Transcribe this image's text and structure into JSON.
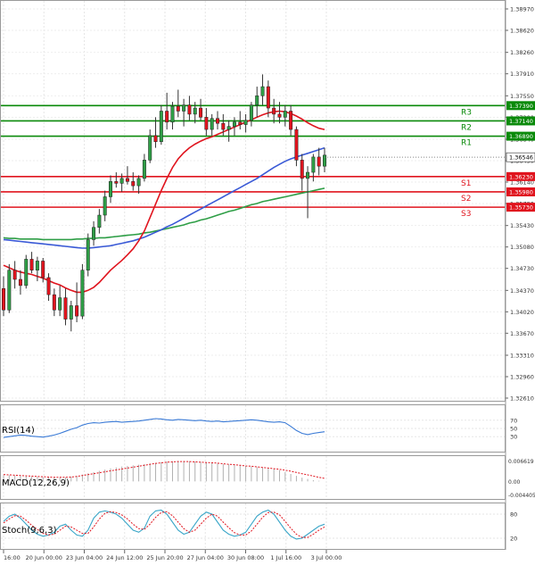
{
  "chart_data": {
    "type": "candlestick",
    "main": {
      "ylim": [
        1.3261,
        1.3897
      ],
      "y_ticks": [
        "1.38970",
        "1.38620",
        "1.38260",
        "1.37910",
        "1.37550",
        "1.37200",
        "1.36840",
        "1.36490",
        "1.36140",
        "1.35790",
        "1.35430",
        "1.35080",
        "1.34730",
        "1.34370",
        "1.34020",
        "1.33670",
        "1.33310",
        "1.32960",
        "1.32610"
      ],
      "x_labels": [
        "16:00",
        "20 Jun 00:00",
        "23 Jun 04:00",
        "24 Jun 12:00",
        "25 Jun 20:00",
        "27 Jun 04:00",
        "30 Jun 08:00",
        "1 Jul 16:00",
        "3 Jul 00:00"
      ],
      "levels": [
        {
          "name": "R3",
          "value": 1.3739,
          "label": "1.37390",
          "color": "#0a8a0a"
        },
        {
          "name": "R2",
          "value": 1.3714,
          "label": "1.37140",
          "color": "#0a8a0a"
        },
        {
          "name": "R1",
          "value": 1.3689,
          "label": "1.36890",
          "color": "#0a8a0a"
        },
        {
          "name": "S1",
          "value": 1.3623,
          "label": "1.36230",
          "color": "#e0141e"
        },
        {
          "name": "S2",
          "value": 1.3598,
          "label": "1.35980",
          "color": "#e0141e"
        },
        {
          "name": "S3",
          "value": 1.3573,
          "label": "1.35730",
          "color": "#e0141e"
        }
      ],
      "current_price": {
        "value": 1.36546,
        "label": "1.36546"
      },
      "candles": [
        [
          1.344,
          1.346,
          1.3395,
          1.3405
        ],
        [
          1.3405,
          1.348,
          1.34,
          1.347
        ],
        [
          1.347,
          1.3485,
          1.344,
          1.3455
        ],
        [
          1.3455,
          1.347,
          1.343,
          1.3445
        ],
        [
          1.3445,
          1.3495,
          1.344,
          1.3488
        ],
        [
          1.3488,
          1.35,
          1.3465,
          1.347
        ],
        [
          1.347,
          1.3492,
          1.3452,
          1.3485
        ],
        [
          1.3485,
          1.349,
          1.345,
          1.3458
        ],
        [
          1.3458,
          1.3465,
          1.342,
          1.343
        ],
        [
          1.343,
          1.344,
          1.3395,
          1.3405
        ],
        [
          1.3405,
          1.3445,
          1.3395,
          1.3425
        ],
        [
          1.3425,
          1.344,
          1.338,
          1.339
        ],
        [
          1.339,
          1.342,
          1.337,
          1.3412
        ],
        [
          1.3412,
          1.345,
          1.3385,
          1.3395
        ],
        [
          1.3395,
          1.348,
          1.339,
          1.347
        ],
        [
          1.347,
          1.353,
          1.346,
          1.352
        ],
        [
          1.352,
          1.355,
          1.351,
          1.354
        ],
        [
          1.354,
          1.357,
          1.353,
          1.356
        ],
        [
          1.356,
          1.36,
          1.355,
          1.359
        ],
        [
          1.359,
          1.3625,
          1.358,
          1.3615
        ],
        [
          1.3615,
          1.363,
          1.3605,
          1.3612
        ],
        [
          1.3612,
          1.3628,
          1.3598,
          1.362
        ],
        [
          1.362,
          1.364,
          1.361,
          1.3615
        ],
        [
          1.3615,
          1.363,
          1.36,
          1.3608
        ],
        [
          1.3608,
          1.3625,
          1.3595,
          1.362
        ],
        [
          1.362,
          1.366,
          1.3615,
          1.365
        ],
        [
          1.365,
          1.37,
          1.3645,
          1.369
        ],
        [
          1.369,
          1.372,
          1.367,
          1.368
        ],
        [
          1.368,
          1.374,
          1.3675,
          1.373
        ],
        [
          1.373,
          1.376,
          1.37,
          1.3712
        ],
        [
          1.3712,
          1.3745,
          1.37,
          1.3738
        ],
        [
          1.3738,
          1.3765,
          1.372,
          1.373
        ],
        [
          1.373,
          1.375,
          1.3705,
          1.374
        ],
        [
          1.374,
          1.3755,
          1.3715,
          1.3725
        ],
        [
          1.3725,
          1.3745,
          1.371,
          1.3735
        ],
        [
          1.3735,
          1.375,
          1.3715,
          1.372
        ],
        [
          1.372,
          1.3735,
          1.369,
          1.37
        ],
        [
          1.37,
          1.3725,
          1.369,
          1.3718
        ],
        [
          1.3718,
          1.373,
          1.37,
          1.371
        ],
        [
          1.371,
          1.3725,
          1.369,
          1.37
        ],
        [
          1.37,
          1.3715,
          1.368,
          1.3705
        ],
        [
          1.3705,
          1.372,
          1.369,
          1.3712
        ],
        [
          1.3712,
          1.373,
          1.37,
          1.3708
        ],
        [
          1.3708,
          1.3725,
          1.3695,
          1.3715
        ],
        [
          1.3715,
          1.3745,
          1.3705,
          1.374
        ],
        [
          1.374,
          1.377,
          1.372,
          1.3755
        ],
        [
          1.3755,
          1.379,
          1.374,
          1.377
        ],
        [
          1.377,
          1.378,
          1.372,
          1.3735
        ],
        [
          1.3735,
          1.375,
          1.371,
          1.3725
        ],
        [
          1.3725,
          1.3745,
          1.371,
          1.372
        ],
        [
          1.372,
          1.374,
          1.3705,
          1.373
        ],
        [
          1.373,
          1.374,
          1.369,
          1.37
        ],
        [
          1.37,
          1.3705,
          1.364,
          1.365
        ],
        [
          1.365,
          1.366,
          1.36,
          1.362
        ],
        [
          1.362,
          1.364,
          1.3555,
          1.363
        ],
        [
          1.363,
          1.366,
          1.3615,
          1.3655
        ],
        [
          1.3655,
          1.367,
          1.3625,
          1.364
        ],
        [
          1.364,
          1.367,
          1.363,
          1.3658
        ]
      ],
      "ma_red": {
        "color": "#e0141e",
        "values": [
          1.3478,
          1.3474,
          1.347,
          1.3467,
          1.3465,
          1.3463,
          1.346,
          1.3457,
          1.3453,
          1.3449,
          1.3446,
          1.3441,
          1.3437,
          1.3434,
          1.3434,
          1.3437,
          1.3442,
          1.345,
          1.346,
          1.347,
          1.3478,
          1.3486,
          1.3495,
          1.3505,
          1.3518,
          1.3534,
          1.3556,
          1.3578,
          1.36,
          1.362,
          1.3638,
          1.3652,
          1.3662,
          1.367,
          1.3676,
          1.3681,
          1.3685,
          1.3688,
          1.3692,
          1.3696,
          1.37,
          1.3704,
          1.3708,
          1.3712,
          1.3716,
          1.372,
          1.3724,
          1.3727,
          1.3729,
          1.373,
          1.3729,
          1.3726,
          1.3722,
          1.3717,
          1.3711,
          1.3706,
          1.3702,
          1.37
        ]
      },
      "ma_blue": {
        "color": "#3a5ad6",
        "values": [
          1.352,
          1.3519,
          1.3518,
          1.3517,
          1.3516,
          1.3515,
          1.3514,
          1.3513,
          1.3512,
          1.3511,
          1.351,
          1.3509,
          1.3508,
          1.3507,
          1.3506,
          1.3506,
          1.3507,
          1.3508,
          1.3509,
          1.351,
          1.3512,
          1.3514,
          1.3516,
          1.3518,
          1.3521,
          1.3524,
          1.3528,
          1.3532,
          1.3536,
          1.3541,
          1.3545,
          1.355,
          1.3555,
          1.356,
          1.3565,
          1.357,
          1.3575,
          1.358,
          1.3585,
          1.359,
          1.3595,
          1.36,
          1.3605,
          1.361,
          1.3615,
          1.362,
          1.3626,
          1.3632,
          1.3638,
          1.3643,
          1.3648,
          1.3652,
          1.3655,
          1.3658,
          1.3661,
          1.3664,
          1.3667,
          1.367
        ]
      },
      "ma_green": {
        "color": "#2e9e46",
        "values": [
          1.3523,
          1.3522,
          1.3522,
          1.3521,
          1.3521,
          1.3521,
          1.3521,
          1.352,
          1.352,
          1.352,
          1.352,
          1.352,
          1.352,
          1.3521,
          1.3521,
          1.3522,
          1.3522,
          1.3523,
          1.3523,
          1.3524,
          1.3525,
          1.3526,
          1.3527,
          1.3528,
          1.3529,
          1.3531,
          1.3532,
          1.3534,
          1.3536,
          1.3538,
          1.354,
          1.3542,
          1.3544,
          1.3547,
          1.3549,
          1.3552,
          1.3554,
          1.3557,
          1.356,
          1.3563,
          1.3566,
          1.3568,
          1.3571,
          1.3574,
          1.3577,
          1.3579,
          1.3582,
          1.3584,
          1.3586,
          1.3588,
          1.359,
          1.3592,
          1.3594,
          1.3596,
          1.3598,
          1.36,
          1.3602,
          1.3604
        ]
      }
    },
    "rsi": {
      "label": "RSI(14)",
      "ylim": [
        0,
        100
      ],
      "ticks": [
        "70",
        "50",
        "30"
      ],
      "color": "#3a7ad6",
      "values": [
        28,
        30,
        32,
        34,
        33,
        31,
        30,
        29,
        31,
        34,
        38,
        43,
        48,
        52,
        58,
        62,
        64,
        63,
        65,
        66,
        67,
        65,
        66,
        67,
        68,
        70,
        72,
        74,
        73,
        71,
        70,
        72,
        71,
        70,
        69,
        70,
        68,
        67,
        68,
        66,
        67,
        68,
        69,
        70,
        71,
        70,
        68,
        66,
        65,
        66,
        64,
        55,
        45,
        38,
        35,
        38,
        40,
        42
      ]
    },
    "macd": {
      "label": "MACD(12,26,9)",
      "ylim": [
        -0.0048,
        0.0073
      ],
      "ticks": [
        "0.006619",
        "0.00",
        "-0.004405"
      ],
      "signal_color": "#e0141e",
      "hist": [
        0.002,
        0.002,
        0.0019,
        0.0018,
        0.0017,
        0.0016,
        0.0015,
        0.0014,
        0.0013,
        0.0012,
        0.0012,
        0.0013,
        0.0015,
        0.0018,
        0.0022,
        0.0026,
        0.003,
        0.0034,
        0.0038,
        0.0042,
        0.0045,
        0.0048,
        0.005,
        0.0052,
        0.0054,
        0.0056,
        0.0058,
        0.006,
        0.0062,
        0.0064,
        0.0065,
        0.0066,
        0.0066,
        0.0065,
        0.0064,
        0.0063,
        0.0062,
        0.006,
        0.0058,
        0.0056,
        0.0055,
        0.0054,
        0.0052,
        0.005,
        0.0048,
        0.0046,
        0.0044,
        0.0042,
        0.004,
        0.0036,
        0.003,
        0.0024,
        0.0018,
        0.0012,
        0.0008,
        0.0004,
        0.0002,
        0.0
      ],
      "signal": [
        0.0022,
        0.0021,
        0.002,
        0.0019,
        0.0018,
        0.0017,
        0.0016,
        0.0015,
        0.0014,
        0.0013,
        0.0013,
        0.0013,
        0.0014,
        0.0016,
        0.0019,
        0.0022,
        0.0025,
        0.0028,
        0.0031,
        0.0034,
        0.0037,
        0.004,
        0.0043,
        0.0046,
        0.0049,
        0.0052,
        0.0055,
        0.0058,
        0.006,
        0.0062,
        0.0063,
        0.0064,
        0.0064,
        0.0064,
        0.0063,
        0.0062,
        0.0061,
        0.006,
        0.0059,
        0.0057,
        0.0055,
        0.0054,
        0.0052,
        0.005,
        0.0049,
        0.0047,
        0.0045,
        0.0043,
        0.0041,
        0.0039,
        0.0036,
        0.0033,
        0.0029,
        0.0025,
        0.0021,
        0.0017,
        0.0013,
        0.001
      ]
    },
    "stoch": {
      "label": "Stoch(9,6,3)",
      "ylim": [
        0,
        100
      ],
      "ticks": [
        "80",
        "20"
      ],
      "k_color": "#3aa6c8",
      "d_color": "#e0141e",
      "k": [
        62,
        75,
        80,
        70,
        55,
        40,
        30,
        25,
        28,
        35,
        50,
        55,
        40,
        28,
        25,
        40,
        70,
        85,
        88,
        85,
        80,
        70,
        55,
        40,
        35,
        45,
        75,
        88,
        90,
        80,
        60,
        40,
        30,
        35,
        55,
        75,
        85,
        80,
        60,
        40,
        30,
        25,
        28,
        35,
        55,
        75,
        85,
        90,
        80,
        60,
        40,
        25,
        18,
        20,
        30,
        40,
        50,
        55
      ],
      "d": [
        58,
        68,
        76,
        75,
        65,
        52,
        42,
        32,
        28,
        30,
        40,
        50,
        48,
        40,
        32,
        32,
        48,
        68,
        82,
        86,
        84,
        78,
        68,
        55,
        44,
        42,
        55,
        72,
        84,
        86,
        76,
        60,
        44,
        35,
        40,
        55,
        70,
        80,
        75,
        60,
        46,
        34,
        28,
        28,
        38,
        55,
        72,
        84,
        85,
        78,
        62,
        45,
        30,
        22,
        22,
        30,
        40,
        48
      ]
    }
  }
}
